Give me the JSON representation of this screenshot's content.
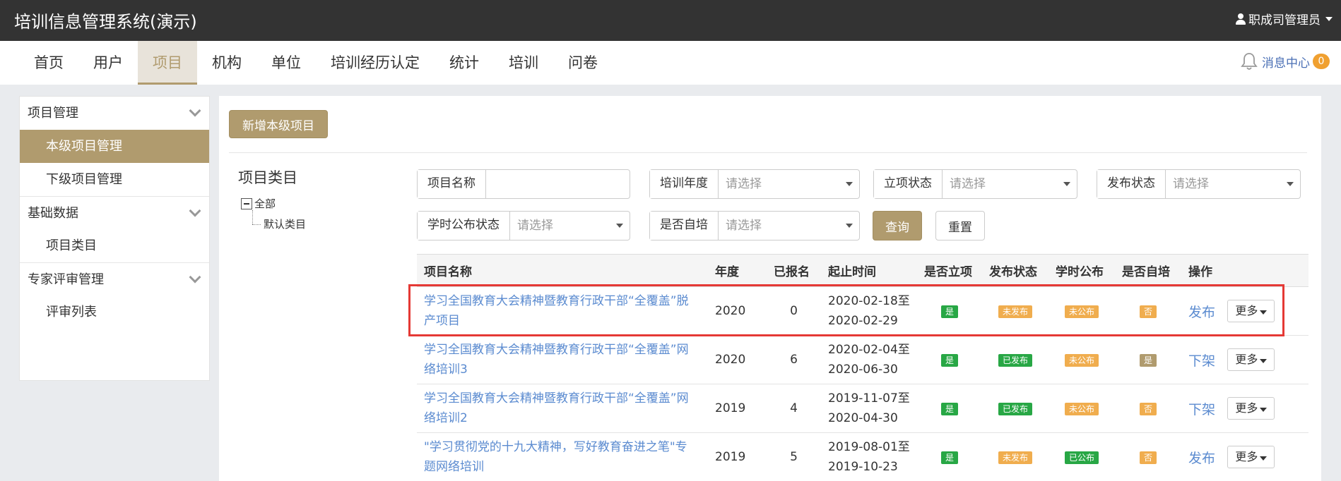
{
  "app": {
    "title": "培训信息管理系统(演示)",
    "user": "职成司管理员"
  },
  "nav": {
    "items": [
      "首页",
      "用户",
      "项目",
      "机构",
      "单位",
      "培训经历认定",
      "统计",
      "培训",
      "问卷"
    ],
    "active": "项目",
    "message_label": "消息中心",
    "message_count": "0"
  },
  "sidebar": {
    "groups": [
      {
        "label": "项目管理",
        "items": [
          "本级项目管理",
          "下级项目管理"
        ]
      },
      {
        "label": "基础数据",
        "items": [
          "项目类目"
        ]
      },
      {
        "label": "专家评审管理",
        "items": [
          "评审列表"
        ]
      }
    ],
    "active_item": "本级项目管理"
  },
  "main": {
    "add_button": "新增本级项目",
    "tree": {
      "title": "项目类目",
      "root": "全部",
      "child": "默认类目"
    },
    "filters": {
      "name_label": "项目名称",
      "name_value": "",
      "year_label": "培训年度",
      "approval_label": "立项状态",
      "publish_label": "发布状态",
      "hours_label": "学时公布状态",
      "self_label": "是否自培",
      "placeholder": "请选择",
      "query_button": "查询",
      "reset_button": "重置"
    },
    "table": {
      "headers": [
        "项目名称",
        "年度",
        "已报名",
        "起止时间",
        "是否立项",
        "发布状态",
        "学时公布",
        "是否自培",
        "操作"
      ],
      "more_label": "更多",
      "rows": [
        {
          "name": "学习全国教育大会精神暨教育行政干部“全覆盖”脱产项目",
          "year": "2020",
          "enrolled": "0",
          "start": "2020-02-18至",
          "end": "2020-02-29",
          "approved": "是",
          "published": "未发布",
          "hours": "未公布",
          "self": "否",
          "action": "发布"
        },
        {
          "name": "学习全国教育大会精神暨教育行政干部“全覆盖”网络培训3",
          "year": "2020",
          "enrolled": "6",
          "start": "2020-02-04至",
          "end": "2020-06-30",
          "approved": "是",
          "published": "已发布",
          "hours": "未公布",
          "self": "是",
          "action": "下架"
        },
        {
          "name": "学习全国教育大会精神暨教育行政干部“全覆盖”网络培训2",
          "year": "2019",
          "enrolled": "4",
          "start": "2019-11-07至",
          "end": "2020-04-30",
          "approved": "是",
          "published": "已发布",
          "hours": "未公布",
          "self": "否",
          "action": "下架"
        },
        {
          "name": "\"学习贯彻党的十九大精神，写好教育奋进之笔\"专题网络培训",
          "year": "2019",
          "enrolled": "5",
          "start": "2019-08-01至",
          "end": "2019-10-23",
          "approved": "是",
          "published": "未发布",
          "hours": "已公布",
          "self": "否",
          "action": "发布"
        }
      ]
    }
  },
  "colors": {
    "accent": "#b09b6e",
    "topbar": "#333333",
    "link": "#5b8bd0",
    "tag_green": "#28a745",
    "tag_orange": "#f0ad4e",
    "highlight": "#e53935"
  }
}
